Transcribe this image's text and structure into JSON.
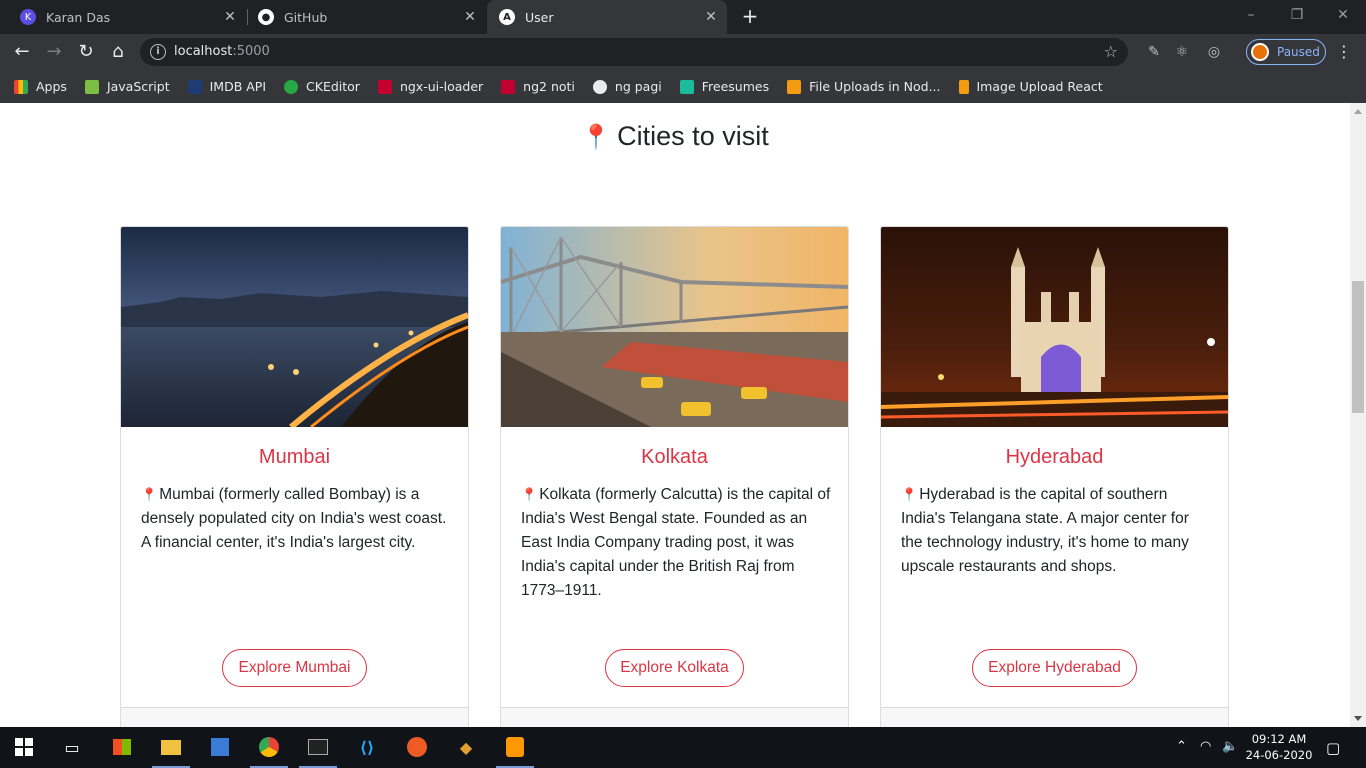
{
  "browser": {
    "tabs": [
      {
        "title": "Karan Das",
        "icon": "karan-icon"
      },
      {
        "title": "GitHub",
        "icon": "github-icon"
      },
      {
        "title": "User",
        "icon": "angular-icon",
        "active": true
      }
    ],
    "url_host": "localhost",
    "url_port": ":5000",
    "profile_status": "Paused",
    "bookmarks": [
      {
        "label": "Apps",
        "color": "#e06c2b"
      },
      {
        "label": "JavaScript",
        "color": "#7bc043"
      },
      {
        "label": "IMDB API",
        "color": "#1f3b73"
      },
      {
        "label": "CKEditor",
        "color": "#27a844"
      },
      {
        "label": "ngx-ui-loader",
        "color": "#c3002f"
      },
      {
        "label": "ng2 noti",
        "color": "#c3002f"
      },
      {
        "label": "ng pagi",
        "color": "#e8eaed"
      },
      {
        "label": "Freesumes",
        "color": "#1abc9c"
      },
      {
        "label": "File Uploads in Nod...",
        "color": "#f39c12"
      },
      {
        "label": "Image Upload React",
        "color": "#f39c12"
      }
    ]
  },
  "page": {
    "heading": "Cities to visit",
    "accent_color": "#dc3545",
    "cards": [
      {
        "title": "Mumbai",
        "description": "Mumbai (formerly called Bombay) is a densely populated city on India's west coast. A financial center, it's India's largest city.",
        "button": "Explore Mumbai",
        "image": "mumbai-marine-drive-night-image",
        "footer_date": ""
      },
      {
        "title": "Kolkata",
        "description": "Kolkata (formerly Calcutta) is the capital of India's West Bengal state. Founded as an East India Company trading post, it was India's capital under the British Raj from 1773–1911.",
        "button": "Explore Kolkata",
        "image": "kolkata-howrah-bridge-image",
        "footer_date": ""
      },
      {
        "title": "Hyderabad",
        "description": "Hyderabad is the capital of southern India's Telangana state. A major center for the technology industry, it's home to many upscale restaurants and shops.",
        "button": "Explore Hyderabad",
        "image": "hyderabad-charminar-night-image",
        "footer_date": ""
      }
    ]
  },
  "taskbar": {
    "time": "09:12 AM",
    "date": "24-06-2020"
  }
}
